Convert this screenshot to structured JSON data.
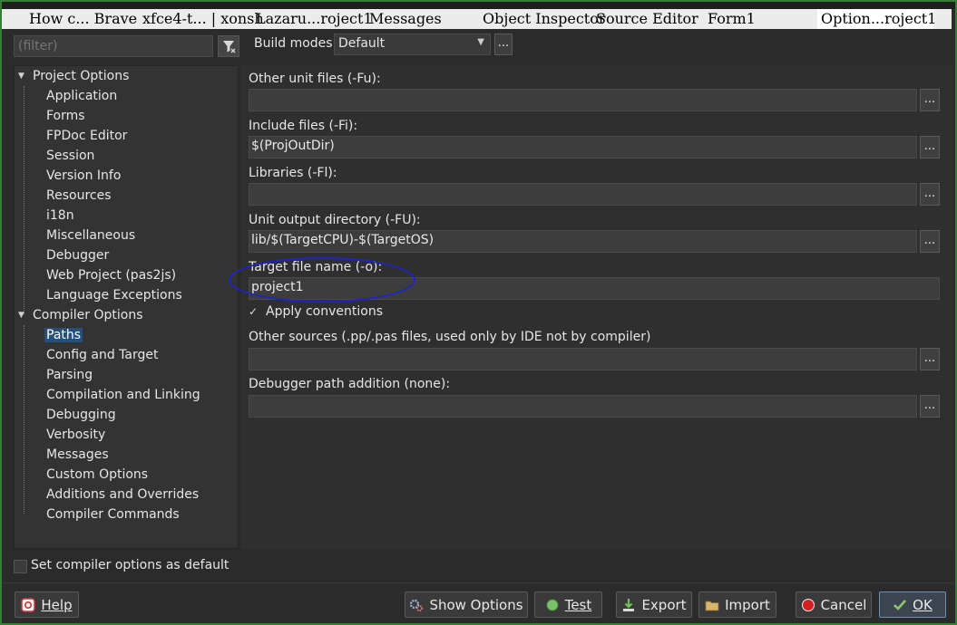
{
  "taskbar": {
    "items": [
      "How c... Brave",
      "xfce4-t... | xonsh",
      "Lazaru...roject1",
      "Messages",
      "Object Inspector",
      "Source Editor",
      "Form1",
      "Option...roject1"
    ]
  },
  "filter": {
    "placeholder": "(filter)"
  },
  "tree": {
    "groups": [
      {
        "label": "Project Options",
        "items": [
          "Application",
          "Forms",
          "FPDoc Editor",
          "Session",
          "Version Info",
          "Resources",
          "i18n",
          "Miscellaneous",
          "Debugger",
          "Web Project (pas2js)",
          "Language Exceptions"
        ]
      },
      {
        "label": "Compiler Options",
        "items": [
          "Paths",
          "Config and Target",
          "Parsing",
          "Compilation and Linking",
          "Debugging",
          "Verbosity",
          "Messages",
          "Custom Options",
          "Additions and Overrides",
          "Compiler Commands"
        ]
      }
    ],
    "selected": "Paths"
  },
  "build_modes": {
    "label": "Build modes",
    "value": "Default",
    "dots": "..."
  },
  "fields": [
    {
      "label": "Other unit files (-Fu):",
      "value": ""
    },
    {
      "label": "Include files (-Fi):",
      "value": "$(ProjOutDir)"
    },
    {
      "label": "Libraries (-Fl):",
      "value": ""
    },
    {
      "label": "Unit output directory (-FU):",
      "value": "lib/$(TargetCPU)-$(TargetOS)"
    },
    {
      "label": "Target file name (-o):",
      "value": "project1"
    },
    {
      "label": "Other sources (.pp/.pas files, used only by IDE not by compiler)",
      "value": ""
    },
    {
      "label": "Debugger path addition (none):",
      "value": ""
    }
  ],
  "dots_label": "...",
  "apply_conventions": {
    "label": "Apply conventions",
    "checked": true
  },
  "set_default": {
    "label": "Set compiler options as default",
    "checked": false
  },
  "buttons": {
    "help": "Help",
    "show_options": "Show Options",
    "test": "Test",
    "export": "Export",
    "import": "Import",
    "cancel": "Cancel",
    "ok": "OK"
  },
  "colors": {
    "accent_circle": "#1d24c8",
    "selection": "#24507a",
    "cancel_red": "#d61e1e",
    "test_green": "#7cc16a"
  }
}
